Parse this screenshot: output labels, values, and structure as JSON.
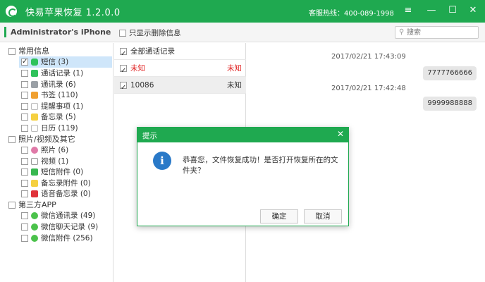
{
  "app": {
    "title": "快易苹果恢复 1.2.0.0",
    "hotline": "客服热线：400-089-1998",
    "accent_color": "#1fa950",
    "window_controls": [
      "≡",
      "—",
      "☐",
      "✕"
    ]
  },
  "toolbar": {
    "device_name": "Administrator's iPhone",
    "show_deleted_label": "只显示删除信息",
    "search_placeholder": "搜索",
    "search_icon": "search-icon"
  },
  "sidebar": {
    "categories": [
      {
        "label": "常用信息",
        "items": [
          {
            "label": "短信 (3)",
            "icon": "sms-icon",
            "checked": true,
            "selected": true
          },
          {
            "label": "通话记录 (1)",
            "icon": "phone-icon",
            "checked": false
          },
          {
            "label": "通讯录 (6)",
            "icon": "contacts-icon",
            "checked": false
          },
          {
            "label": "书签 (110)",
            "icon": "bookmark-icon",
            "checked": false
          },
          {
            "label": "提醒事项 (1)",
            "icon": "reminder-icon",
            "checked": false
          },
          {
            "label": "备忘录 (5)",
            "icon": "notes-icon",
            "checked": false
          },
          {
            "label": "日历 (119)",
            "icon": "calendar-icon",
            "checked": false
          }
        ]
      },
      {
        "label": "照片/视频及其它",
        "items": [
          {
            "label": "照片 (6)",
            "icon": "photos-icon",
            "checked": false
          },
          {
            "label": "视频 (1)",
            "icon": "video-icon",
            "checked": false
          },
          {
            "label": "短信附件 (0)",
            "icon": "sms-attachment-icon",
            "checked": false
          },
          {
            "label": "备忘录附件 (0)",
            "icon": "notes-attachment-icon",
            "checked": false
          },
          {
            "label": "语音备忘录 (0)",
            "icon": "voice-memo-icon",
            "checked": false
          }
        ]
      },
      {
        "label": "第三方APP",
        "items": [
          {
            "label": "微信通讯录 (49)",
            "icon": "wechat-icon",
            "checked": false
          },
          {
            "label": "微信聊天记录 (9)",
            "icon": "wechat-icon",
            "checked": false
          },
          {
            "label": "微信附件 (256)",
            "icon": "wechat-icon",
            "checked": false
          }
        ]
      }
    ]
  },
  "list": {
    "select_all_label": "全部通话记录",
    "rows": [
      {
        "name": "未知",
        "tag": "未知",
        "checked": true,
        "red": true
      },
      {
        "name": "10086",
        "tag": "未知",
        "checked": true,
        "red": false
      }
    ]
  },
  "chat": {
    "messages": [
      {
        "timestamp": "2017/02/21 17:43:09",
        "text": "7777766666"
      },
      {
        "timestamp": "2017/02/21 17:42:48",
        "text": "9999988888"
      }
    ]
  },
  "dialog": {
    "title": "提示",
    "message": "恭喜您，文件恢复成功！是否打开恢复所在的文件夹？",
    "ok_label": "确定",
    "cancel_label": "取消",
    "close_glyph": "✕",
    "info_glyph": "i"
  }
}
